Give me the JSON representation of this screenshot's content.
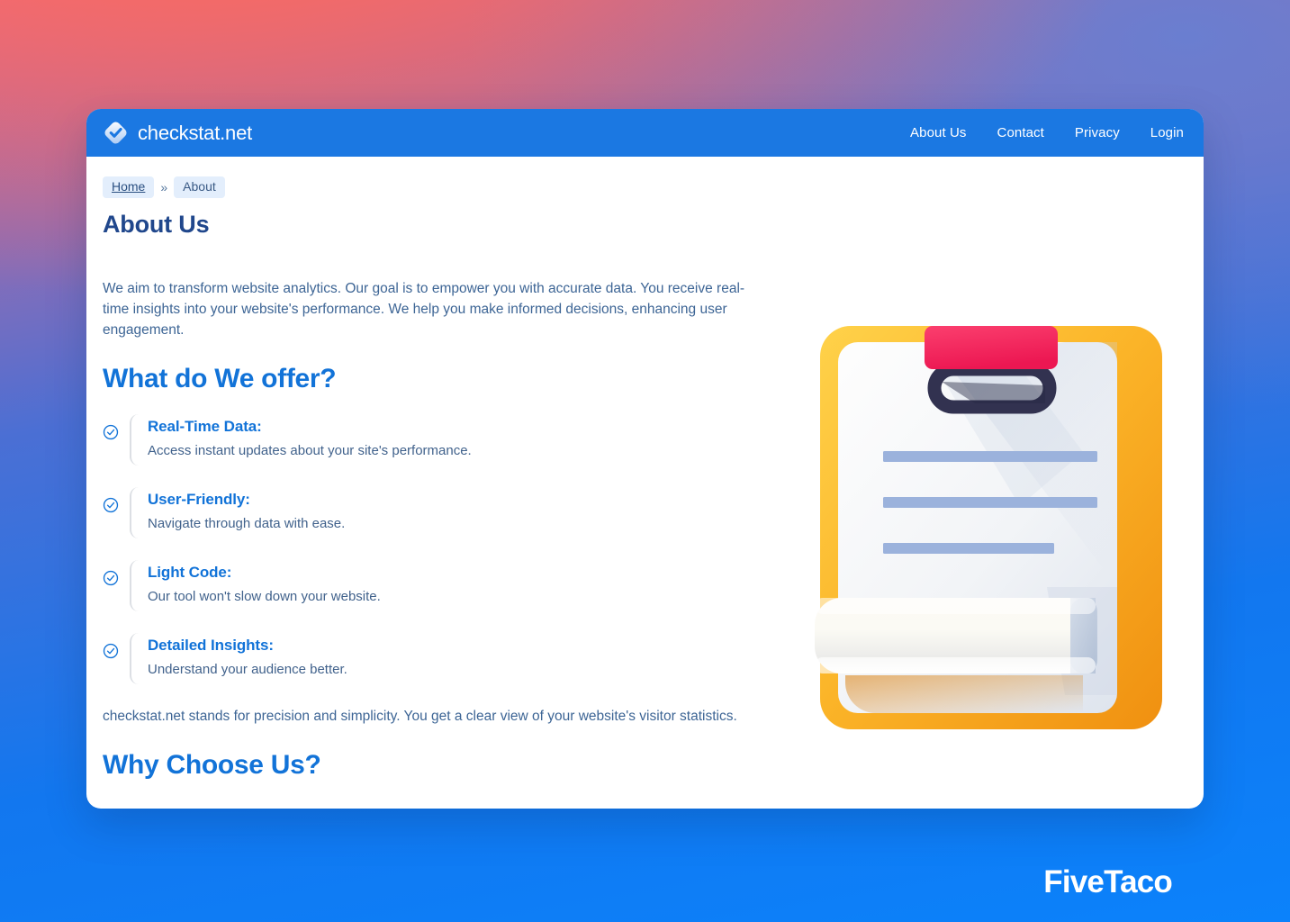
{
  "brand": {
    "name": "checkstat.net",
    "logo_icon": "check-diamond-icon",
    "accent_color": "#1b78e2"
  },
  "nav": {
    "items": [
      {
        "label": "About Us"
      },
      {
        "label": "Contact"
      },
      {
        "label": "Privacy"
      },
      {
        "label": "Login"
      }
    ]
  },
  "breadcrumb": {
    "home_label": "Home",
    "separator": "»",
    "current_label": "About"
  },
  "page": {
    "title": "About Us",
    "intro": "We aim to transform website analytics. Our goal is to empower you with accurate data. You receive real-time insights into your website's performance. We help you make informed decisions, enhancing user engagement.",
    "offer_heading": "What do We offer?",
    "features": [
      {
        "icon": "check-circle-icon",
        "title": "Real-Time Data:",
        "description": "Access instant updates about your site's performance."
      },
      {
        "icon": "check-circle-icon",
        "title": "User-Friendly:",
        "description": "Navigate through data with ease."
      },
      {
        "icon": "check-circle-icon",
        "title": "Light Code:",
        "description": "Our tool won't slow down your website."
      },
      {
        "icon": "check-circle-icon",
        "title": "Detailed Insights:",
        "description": "Understand your audience better."
      }
    ],
    "closing": "checkstat.net stands for precision and simplicity. You get a clear view of your website's visitor statistics.",
    "why_heading": "Why Choose Us?"
  },
  "illustration": {
    "icon": "clipboard-document-icon",
    "board_color": "#f9a825",
    "clip_color": "#f5265c",
    "clip_handle_color": "#323250",
    "line_color": "#9bb2dc"
  },
  "watermark": {
    "text": "FiveTaco"
  },
  "theme": {
    "title_color": "#20478c",
    "heading_color": "#1273d8",
    "body_color": "#3d6595",
    "card_background": "#ffffff"
  }
}
